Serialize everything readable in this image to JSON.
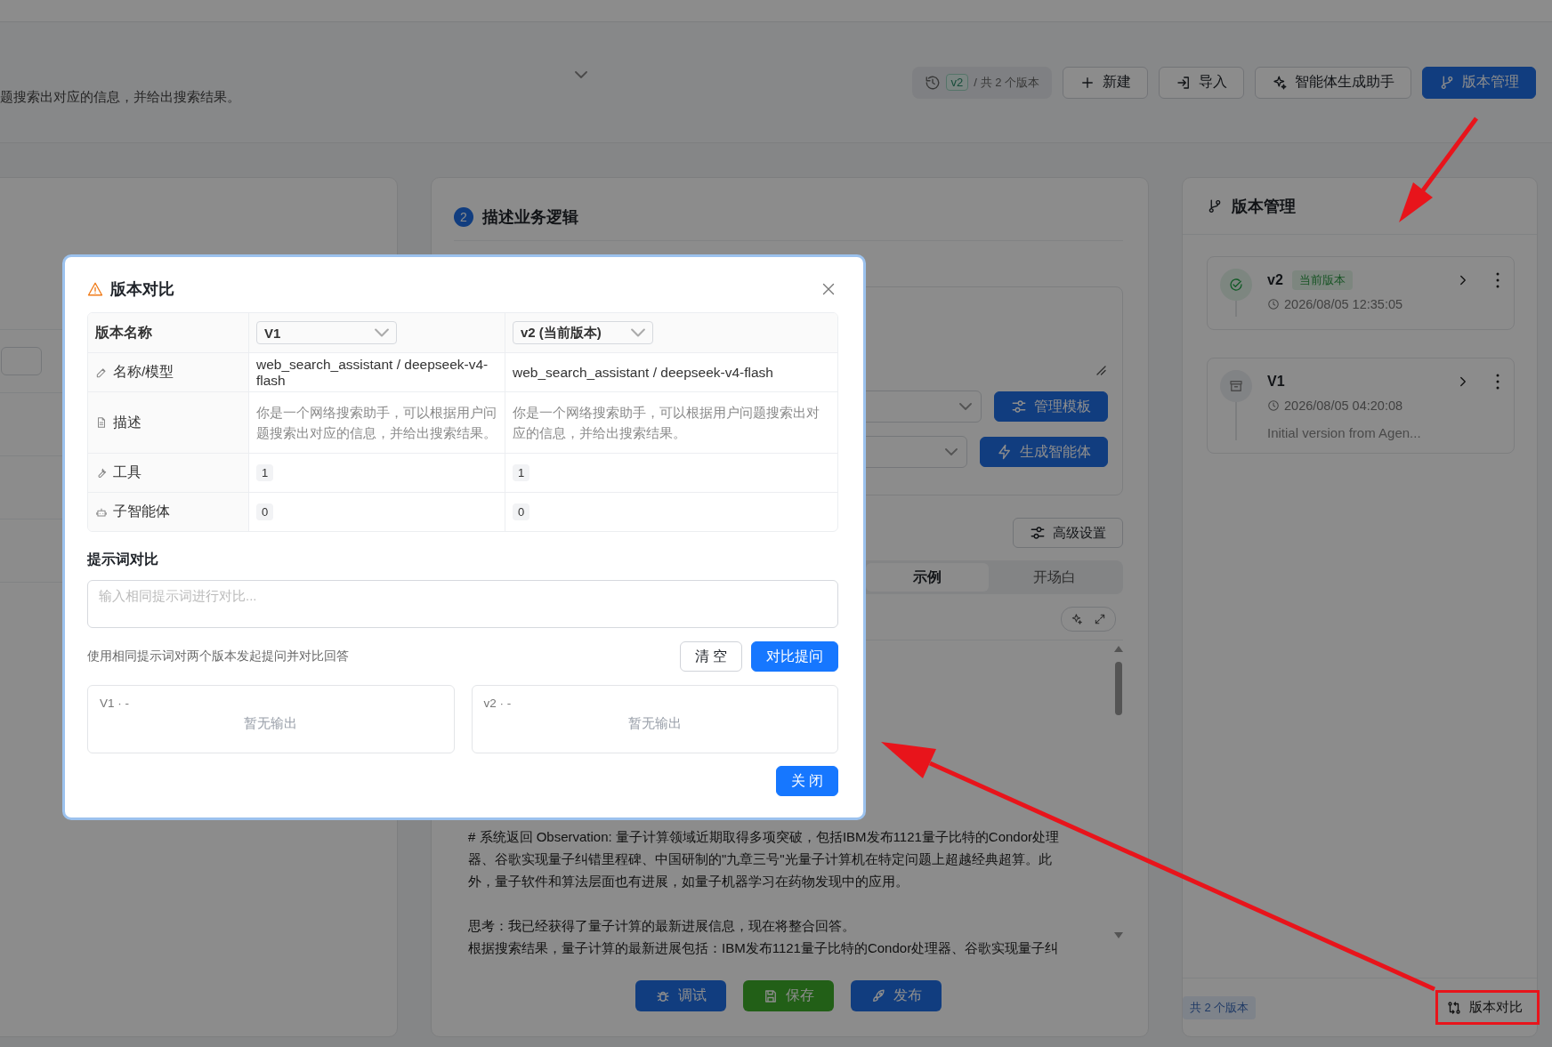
{
  "header": {
    "description": "题搜索出对应的信息，并给出搜索结果。",
    "version_pill": {
      "tag": "v2",
      "total": "/ 共 2 个版本"
    },
    "buttons": [
      {
        "label": "新建",
        "kind": "plus",
        "primary": false
      },
      {
        "label": "导入",
        "kind": "import",
        "primary": false
      },
      {
        "label": "智能体生成助手",
        "kind": "sparkle",
        "primary": false
      },
      {
        "label": "版本管理",
        "kind": "branch",
        "primary": true
      }
    ]
  },
  "editor": {
    "step": "2",
    "title": "描述业务逻辑",
    "template_buttons": [
      {
        "label": "管理模板",
        "kind": "sliders"
      },
      {
        "label": "生成智能体",
        "kind": "bolt"
      }
    ],
    "advanced_button": "高级设置",
    "tabs": [
      {
        "label": "示例",
        "selected": true
      },
      {
        "label": "开场白",
        "selected": false
      }
    ],
    "content": [
      "# 系统返回 Observation: 量子计算领域近期取得多项突破，包括IBM发布1121量子比特的Condor处理器、谷歌实现量子纠错里程碑、中国研制的\"九章三号\"光量子计算机在特定问题上超越经典超算。此外，量子软件和算法层面也有进展，如量子机器学习在药物发现中的应用。",
      "思考：我已经获得了量子计算的最新进展信息，现在将整合回答。",
      "根据搜索结果，量子计算的最新进展包括：IBM发布1121量子比特的Condor处理器、谷歌实现量子纠"
    ],
    "actions": [
      {
        "label": "调试",
        "kind": "debug"
      },
      {
        "label": "保存",
        "kind": "save"
      },
      {
        "label": "发布",
        "kind": "publish"
      }
    ]
  },
  "version_panel": {
    "title": "版本管理",
    "versions": [
      {
        "name": "v2",
        "current": true,
        "badge": "当前版本",
        "time": "2026/08/05 12:35:05"
      },
      {
        "name": "V1",
        "current": false,
        "time": "2026/08/05 04:20:08",
        "note": "Initial version from Agen..."
      }
    ],
    "count": "共 2 个版本",
    "compare_button": "版本对比"
  },
  "dialog": {
    "title": "版本对比",
    "header_label": "版本名称",
    "versions": [
      "V1",
      "v2 (当前版本)"
    ],
    "rows": [
      {
        "kind": "name",
        "label": "名称/模型",
        "values": [
          "web_search_assistant / deepseek-v4-flash",
          "web_search_assistant / deepseek-v4-flash"
        ]
      },
      {
        "kind": "description",
        "label": "描述",
        "values": [
          "你是一个网络搜索助手，可以根据用户问题搜索出对应的信息，并给出搜索结果。",
          "你是一个网络搜索助手，可以根据用户问题搜索出对应的信息，并给出搜索结果。"
        ]
      },
      {
        "kind": "tools",
        "label": "工具",
        "values": [
          "1",
          "1"
        ]
      },
      {
        "kind": "agents",
        "label": "子智能体",
        "values": [
          "0",
          "0"
        ]
      }
    ],
    "prompt_label": "提示词对比",
    "placeholder": "输入相同提示词进行对比...",
    "hint": "使用相同提示词对两个版本发起提问并对比回答",
    "clear_button": "清 空",
    "ask_button": "对比提问",
    "outputs": [
      {
        "title": "V1 · -",
        "empty": "暂无输出"
      },
      {
        "title": "v2 · -",
        "empty": "暂无输出"
      }
    ],
    "close_button": "关 闭"
  }
}
